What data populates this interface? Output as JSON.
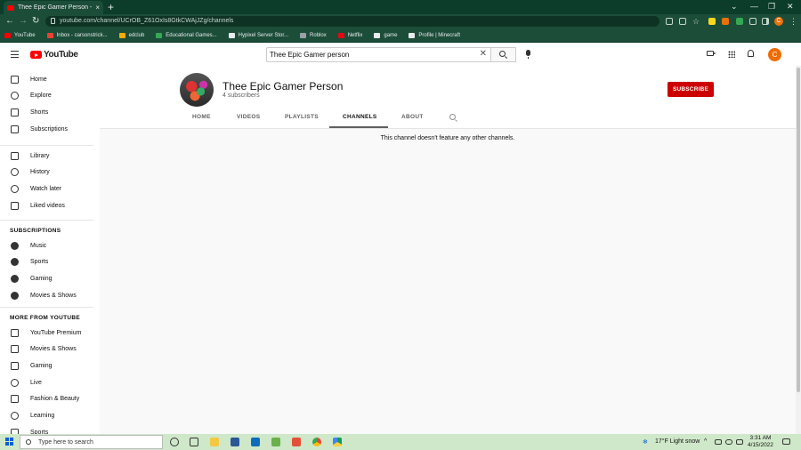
{
  "browser": {
    "tab_title": "Thee Epic Gamer Person - YouTube",
    "tab_close": "×",
    "new_tab": "+",
    "url": "youtube.com/channel/UCrOB_Z61OxIs8GtkCWAjJZg/channels",
    "profile_initial": "C",
    "window_controls": [
      "⌄",
      "—",
      "❐",
      "✕"
    ],
    "nav_back": "←",
    "nav_forward": "→",
    "nav_reload": "↻",
    "bookmarks": [
      {
        "label": "YouTube",
        "color": "#ff0000"
      },
      {
        "label": "Inbox - carsonstrick...",
        "color": "#ea4335"
      },
      {
        "label": "edclub",
        "color": "#f9ab00"
      },
      {
        "label": "Educational Games...",
        "color": "#34a853"
      },
      {
        "label": "Hypixel Server Stor...",
        "color": "#e8eaed"
      },
      {
        "label": "Roblox",
        "color": "#9aa0a6"
      },
      {
        "label": "Netflix",
        "color": "#e50914"
      },
      {
        "label": "game",
        "color": "#e8eaed"
      },
      {
        "label": "Profile | Minecraft",
        "color": "#e8eaed"
      }
    ]
  },
  "youtube": {
    "logo_text": "YouTube",
    "search_query": "Thee Epic Gamer person",
    "search_clear": "✕",
    "avatar_initial": "C"
  },
  "sidebar": {
    "main": [
      {
        "label": "Home",
        "icon": "home-icon"
      },
      {
        "label": "Explore",
        "icon": "compass-icon"
      },
      {
        "label": "Shorts",
        "icon": "shorts-icon"
      },
      {
        "label": "Subscriptions",
        "icon": "subscriptions-icon"
      }
    ],
    "library": [
      {
        "label": "Library",
        "icon": "library-icon"
      },
      {
        "label": "History",
        "icon": "history-icon"
      },
      {
        "label": "Watch later",
        "icon": "clock-icon"
      },
      {
        "label": "Liked videos",
        "icon": "thumbs-up-icon"
      }
    ],
    "subscriptions_heading": "SUBSCRIPTIONS",
    "subscriptions": [
      {
        "label": "Music",
        "icon": "music-icon"
      },
      {
        "label": "Sports",
        "icon": "trophy-icon"
      },
      {
        "label": "Gaming",
        "icon": "gamepad-icon"
      },
      {
        "label": "Movies & Shows",
        "icon": "film-icon"
      }
    ],
    "more_heading": "MORE FROM YOUTUBE",
    "more": [
      {
        "label": "YouTube Premium",
        "icon": "youtube-premium-icon"
      },
      {
        "label": "Movies & Shows",
        "icon": "film-strip-icon"
      },
      {
        "label": "Gaming",
        "icon": "controller-icon"
      },
      {
        "label": "Live",
        "icon": "live-icon"
      },
      {
        "label": "Fashion & Beauty",
        "icon": "hanger-icon"
      },
      {
        "label": "Learning",
        "icon": "lightbulb-icon"
      },
      {
        "label": "Sports",
        "icon": "trophy-outline-icon"
      }
    ]
  },
  "channel": {
    "name": "Thee Epic Gamer Person",
    "subscribers": "4 subscribers",
    "subscribe_label": "SUBSCRIBE",
    "tabs": [
      "HOME",
      "VIDEOS",
      "PLAYLISTS",
      "CHANNELS",
      "ABOUT"
    ],
    "active_tab": "CHANNELS",
    "empty_message": "This channel doesn't feature any other channels."
  },
  "taskbar": {
    "search_placeholder": "Type here to search",
    "weather": "17°F  Light snow",
    "time": "3:31 AM",
    "date": "4/15/2022",
    "tray_arrow": "^"
  },
  "colors": {
    "subscribe_red": "#cc0000",
    "chrome_dark_green": "#1c4d39",
    "taskbar_green": "#cfe8c9"
  }
}
